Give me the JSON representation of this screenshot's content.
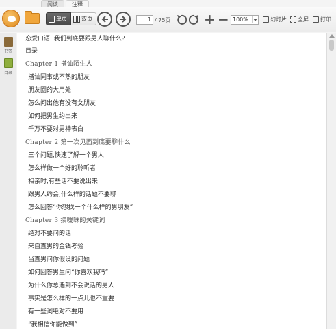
{
  "tabs": [
    "阅读",
    "注释"
  ],
  "toolbar": {
    "single_page": "单页",
    "double_page": "双页",
    "current_page": "1",
    "total_pages": "/ 75页",
    "zoom": "100%",
    "slideshow": "幻灯片",
    "fullscreen": "全屏",
    "print": "打印"
  },
  "sidebar": {
    "bookmark_label": "书签",
    "toc_label": "目录"
  },
  "document": {
    "lines": [
      {
        "text": "恋爱口语: 我们到底要跟男人聊什么?",
        "chapter": false
      },
      {
        "text": "目录",
        "chapter": false
      },
      {
        "text": "Chapter 1  搭讪陌生人",
        "chapter": true
      },
      {
        "text": "搭讪同事或不熟的朋友",
        "chapter": false
      },
      {
        "text": "朋友圈的大用处",
        "chapter": false
      },
      {
        "text": "怎么问出他有没有女朋友",
        "chapter": false
      },
      {
        "text": "如何把男生约出来",
        "chapter": false
      },
      {
        "text": "千万不要对男神表白",
        "chapter": false
      },
      {
        "text": "Chapter 2  第一次见面到底要聊什么",
        "chapter": true
      },
      {
        "text": "三个问题,快速了解一个男人",
        "chapter": false
      },
      {
        "text": "怎么样做一个好的聆听者",
        "chapter": false
      },
      {
        "text": "相亲时,有些话不要说出来",
        "chapter": false
      },
      {
        "text": "跟男人约会,什么样的话题不要聊",
        "chapter": false
      },
      {
        "text": "怎么回答“你想找一个什么样的男朋友”",
        "chapter": false
      },
      {
        "text": "Chapter 3  搞暧昧的关键词",
        "chapter": true
      },
      {
        "text": "绝对不要问的话",
        "chapter": false
      },
      {
        "text": "来自直男的金钱考验",
        "chapter": false
      },
      {
        "text": "当直男问你假设的问题",
        "chapter": false
      },
      {
        "text": "如何回答男生问“你喜欢我吗”",
        "chapter": false
      },
      {
        "text": "为什么你总遇到不会说话的男人",
        "chapter": false
      },
      {
        "text": "事实是怎么样的一点儿也不重要",
        "chapter": false
      },
      {
        "text": "有一些词绝对不要用",
        "chapter": false
      },
      {
        "text": "“我相信你能做到”",
        "chapter": false
      }
    ]
  },
  "colors": {
    "accent_orange": "#e08a1c",
    "toolbar_bg": "#ececec",
    "page_bg": "#ffffff"
  }
}
